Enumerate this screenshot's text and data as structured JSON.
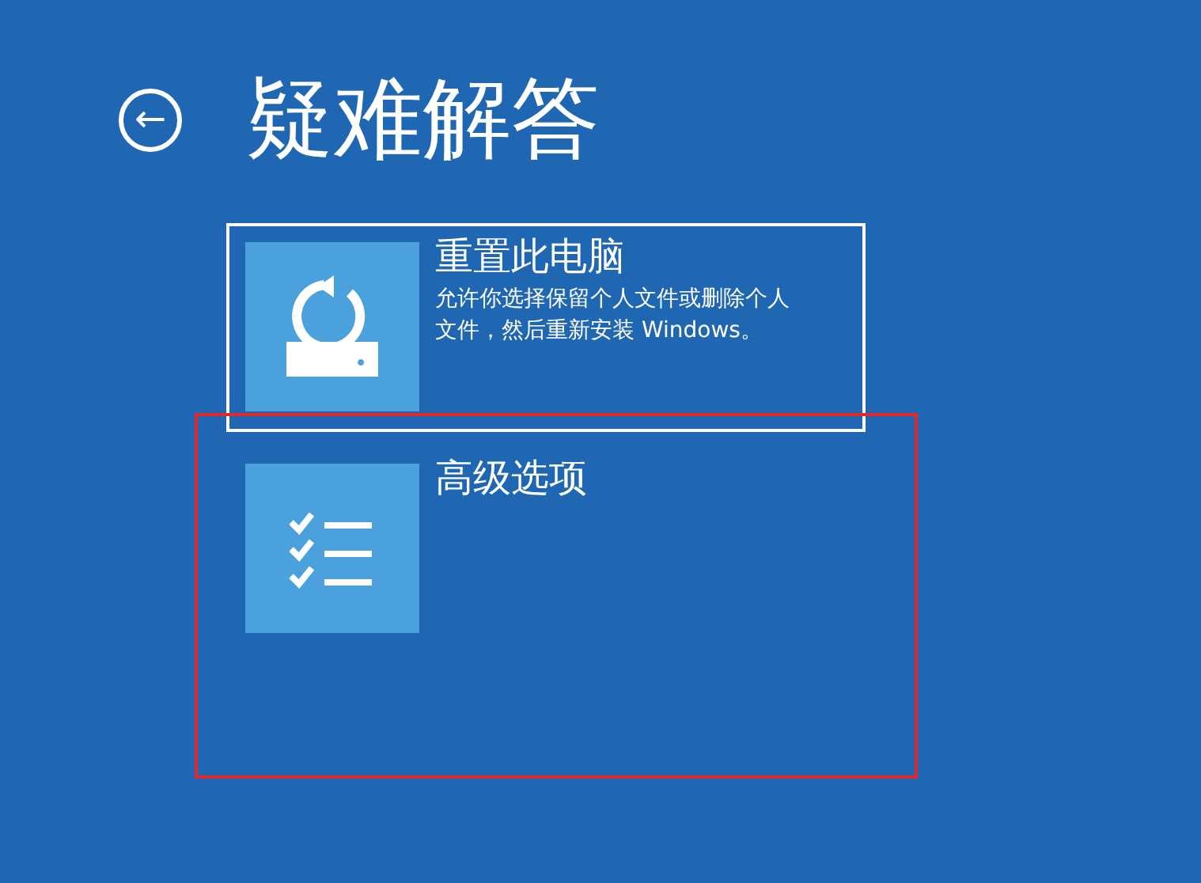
{
  "header": {
    "back_symbol": "←",
    "title": "疑难解答"
  },
  "options": [
    {
      "kind": "reset",
      "title": "重置此电脑",
      "description": "允许你选择保留个人文件或删除个人文件，然后重新安装 Windows。",
      "focused": true,
      "highlighted": false
    },
    {
      "kind": "advanced",
      "title": "高级选项",
      "focused": false,
      "highlighted": true
    }
  ]
}
